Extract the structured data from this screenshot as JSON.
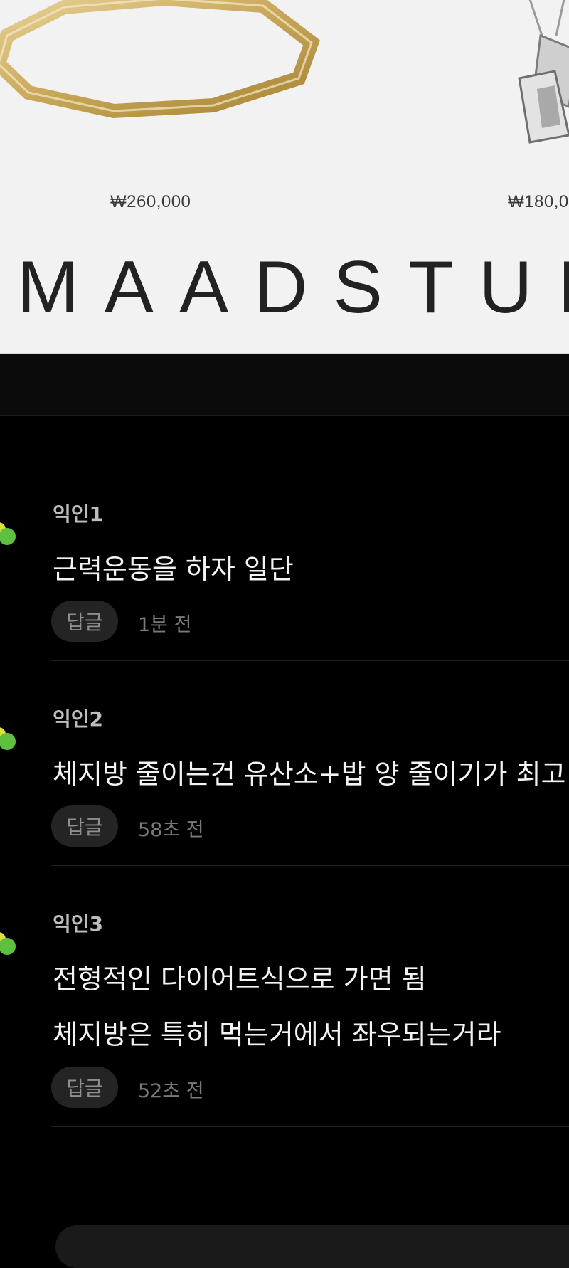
{
  "ad": {
    "products": [
      {
        "price": "₩260,000",
        "icon": "gold-ring-icon"
      },
      {
        "price": "₩180,0",
        "icon": "silver-pendant-icon"
      }
    ],
    "brand": "MAADSTUD"
  },
  "comments": [
    {
      "author": "익인1",
      "lines": [
        "근력운동을 하자 일단"
      ],
      "reply_label": "답글",
      "time": "1분 전"
    },
    {
      "author": "익인2",
      "lines": [
        "체지방 줄이는건 유산소+밥 양 줄이기가 최고"
      ],
      "reply_label": "답글",
      "time": "58초 전"
    },
    {
      "author": "익인3",
      "lines": [
        "전형적인 다이어트식으로 가면 됨",
        "체지방은 특히 먹는거에서 좌우되는거라"
      ],
      "reply_label": "답글",
      "time": "52초 전"
    }
  ],
  "colors": {
    "background": "#000000",
    "reply_button_bg": "#242424",
    "avatar_green": "#5fbf3f",
    "avatar_yellow": "#d8e23a"
  }
}
